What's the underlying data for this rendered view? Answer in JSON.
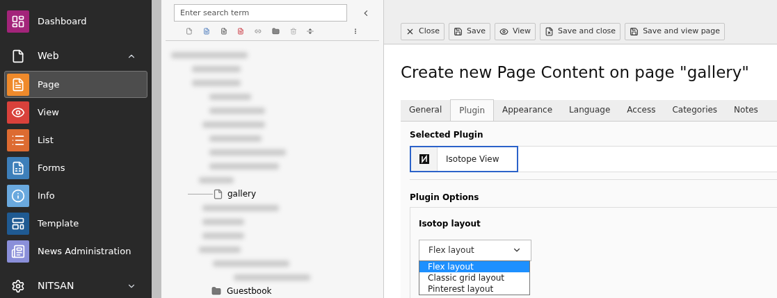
{
  "sidebar": {
    "items": [
      {
        "label": "Dashboard",
        "kind": "module",
        "color": "#a3247a",
        "selected": false
      },
      {
        "label": "Web",
        "kind": "group",
        "expanded": true
      },
      {
        "label": "Page",
        "kind": "module",
        "color": "#ef8a2b",
        "selected": true
      },
      {
        "label": "View",
        "kind": "module",
        "color": "#d9413b",
        "selected": false
      },
      {
        "label": "List",
        "kind": "module",
        "color": "#dd6b31",
        "selected": false
      },
      {
        "label": "Forms",
        "kind": "module",
        "color": "#3d7fba",
        "selected": false
      },
      {
        "label": "Info",
        "kind": "module",
        "color": "#6aa9de",
        "selected": false
      },
      {
        "label": "Template",
        "kind": "module",
        "color": "#1f5a92",
        "selected": false
      },
      {
        "label": "News Administration",
        "kind": "module",
        "color": "#8a8fd9",
        "selected": false
      },
      {
        "label": "NITSAN",
        "kind": "group",
        "expanded": false
      }
    ]
  },
  "page_tree": {
    "search": {
      "placeholder": "Enter search term"
    },
    "items": [
      {
        "label": "gallery",
        "kind": "page"
      },
      {
        "label": "Guestbook",
        "kind": "folder"
      }
    ]
  },
  "toolbar": {
    "buttons": [
      "Close",
      "Save",
      "View",
      "Save and close",
      "Save and view page"
    ]
  },
  "form": {
    "title": "Create new Page Content on page \"gallery\"",
    "tabs": [
      {
        "label": "General",
        "selected": false
      },
      {
        "label": "Plugin",
        "selected": true
      },
      {
        "label": "Appearance",
        "selected": false
      },
      {
        "label": "Language",
        "selected": false
      },
      {
        "label": "Access",
        "selected": false
      },
      {
        "label": "Categories",
        "selected": false
      },
      {
        "label": "Notes",
        "selected": false
      }
    ],
    "selected_plugin": {
      "heading": "Selected Plugin",
      "value": "Isotope View"
    },
    "plugin_options": {
      "heading": "Plugin Options",
      "field_label": "Isotop layout",
      "value": "Flex layout",
      "options": [
        {
          "label": "Flex layout",
          "selected": true
        },
        {
          "label": "Classic grid layout",
          "selected": false
        },
        {
          "label": "Pinterest layout",
          "selected": false
        }
      ]
    }
  }
}
